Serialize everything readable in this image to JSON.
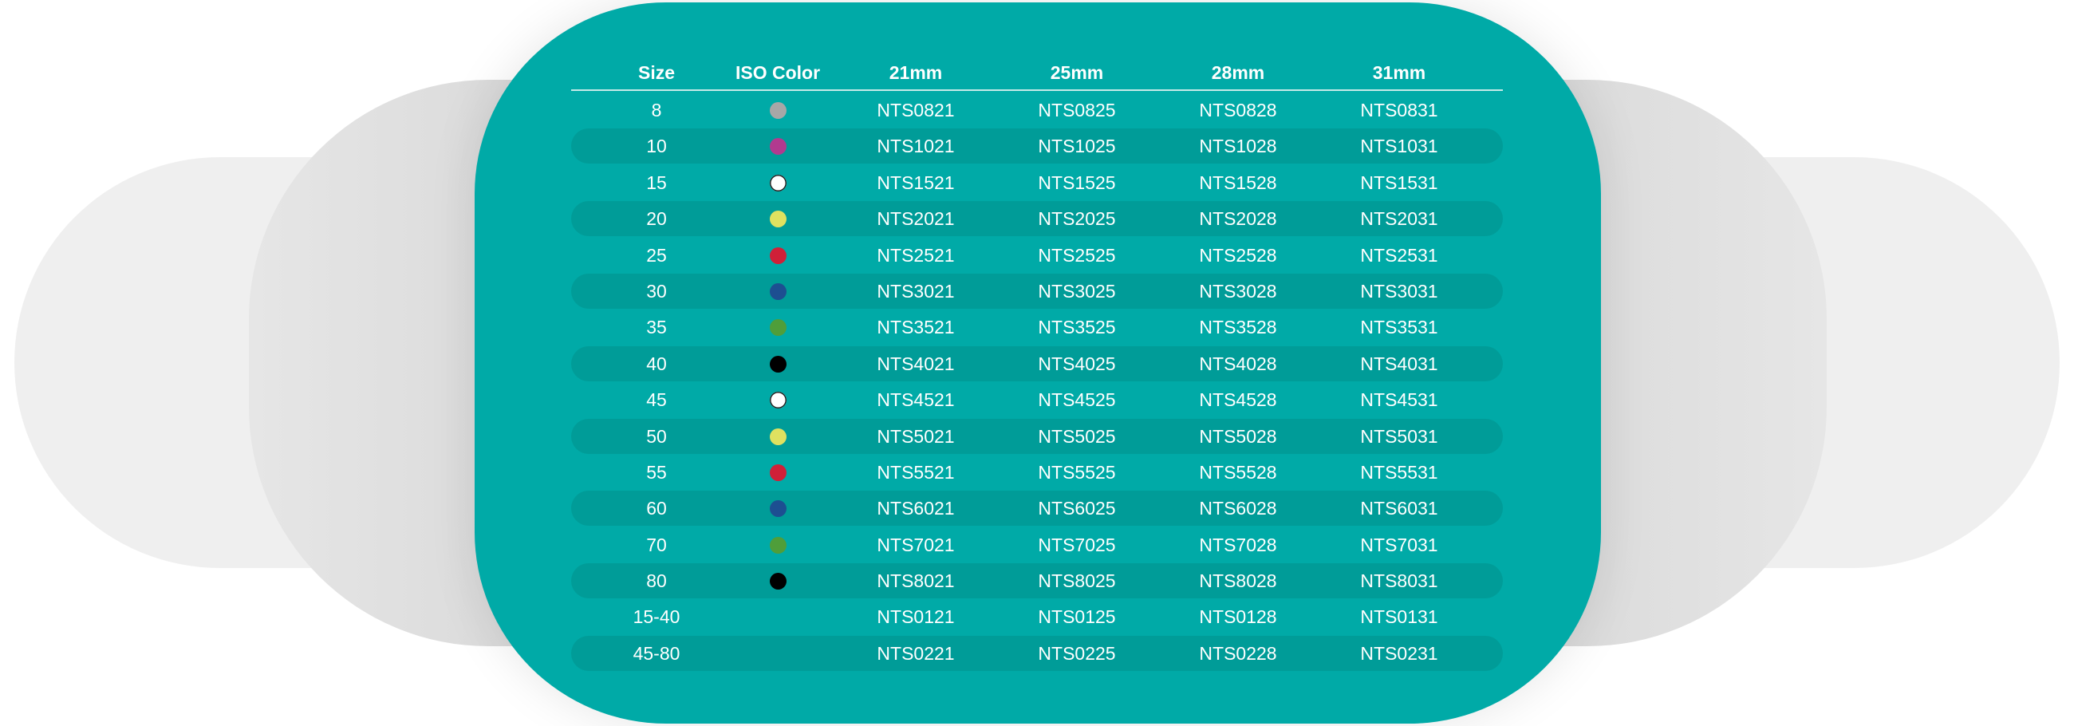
{
  "table": {
    "headers": [
      "Size",
      "ISO Color",
      "21mm",
      "25mm",
      "28mm",
      "31mm"
    ],
    "rows": [
      {
        "size": "8",
        "color": "#a7a7a7",
        "icon": "gray-dot-icon",
        "codes": [
          "NTS0821",
          "NTS0825",
          "NTS0828",
          "NTS0831"
        ]
      },
      {
        "size": "10",
        "color": "#b23a8f",
        "icon": "purple-dot-icon",
        "codes": [
          "NTS1021",
          "NTS1025",
          "NTS1028",
          "NTS1031"
        ]
      },
      {
        "size": "15",
        "color": "#ffffff",
        "icon": "white-dot-icon",
        "codes": [
          "NTS1521",
          "NTS1525",
          "NTS1528",
          "NTS1531"
        ]
      },
      {
        "size": "20",
        "color": "#dfe160",
        "icon": "yellow-dot-icon",
        "codes": [
          "NTS2021",
          "NTS2025",
          "NTS2028",
          "NTS2031"
        ]
      },
      {
        "size": "25",
        "color": "#d02038",
        "icon": "red-dot-icon",
        "codes": [
          "NTS2521",
          "NTS2525",
          "NTS2528",
          "NTS2531"
        ]
      },
      {
        "size": "30",
        "color": "#1d4f91",
        "icon": "blue-dot-icon",
        "codes": [
          "NTS3021",
          "NTS3025",
          "NTS3028",
          "NTS3031"
        ]
      },
      {
        "size": "35",
        "color": "#4f9e3a",
        "icon": "green-dot-icon",
        "codes": [
          "NTS3521",
          "NTS3525",
          "NTS3528",
          "NTS3531"
        ]
      },
      {
        "size": "40",
        "color": "#000000",
        "icon": "black-dot-icon",
        "codes": [
          "NTS4021",
          "NTS4025",
          "NTS4028",
          "NTS4031"
        ]
      },
      {
        "size": "45",
        "color": "#ffffff",
        "icon": "white-dot-icon",
        "codes": [
          "NTS4521",
          "NTS4525",
          "NTS4528",
          "NTS4531"
        ]
      },
      {
        "size": "50",
        "color": "#dfe160",
        "icon": "yellow-dot-icon",
        "codes": [
          "NTS5021",
          "NTS5025",
          "NTS5028",
          "NTS5031"
        ]
      },
      {
        "size": "55",
        "color": "#d02038",
        "icon": "red-dot-icon",
        "codes": [
          "NTS5521",
          "NTS5525",
          "NTS5528",
          "NTS5531"
        ]
      },
      {
        "size": "60",
        "color": "#1d4f91",
        "icon": "blue-dot-icon",
        "codes": [
          "NTS6021",
          "NTS6025",
          "NTS6028",
          "NTS6031"
        ]
      },
      {
        "size": "70",
        "color": "#4f9e3a",
        "icon": "green-dot-icon",
        "codes": [
          "NTS7021",
          "NTS7025",
          "NTS7028",
          "NTS7031"
        ]
      },
      {
        "size": "80",
        "color": "#000000",
        "icon": "black-dot-icon",
        "codes": [
          "NTS8021",
          "NTS8025",
          "NTS8028",
          "NTS8031"
        ]
      },
      {
        "size": "15-40",
        "color": "",
        "icon": "",
        "codes": [
          "NTS0121",
          "NTS0125",
          "NTS0128",
          "NTS0131"
        ]
      },
      {
        "size": "45-80",
        "color": "",
        "icon": "",
        "codes": [
          "NTS0221",
          "NTS0225",
          "NTS0228",
          "NTS0231"
        ]
      }
    ]
  },
  "theme": {
    "card_color": "#00aaa7",
    "stripe_color": "#009c98",
    "text_color": "#ffffff",
    "background_pill_colors": [
      "#efefef",
      "#dedede"
    ]
  }
}
